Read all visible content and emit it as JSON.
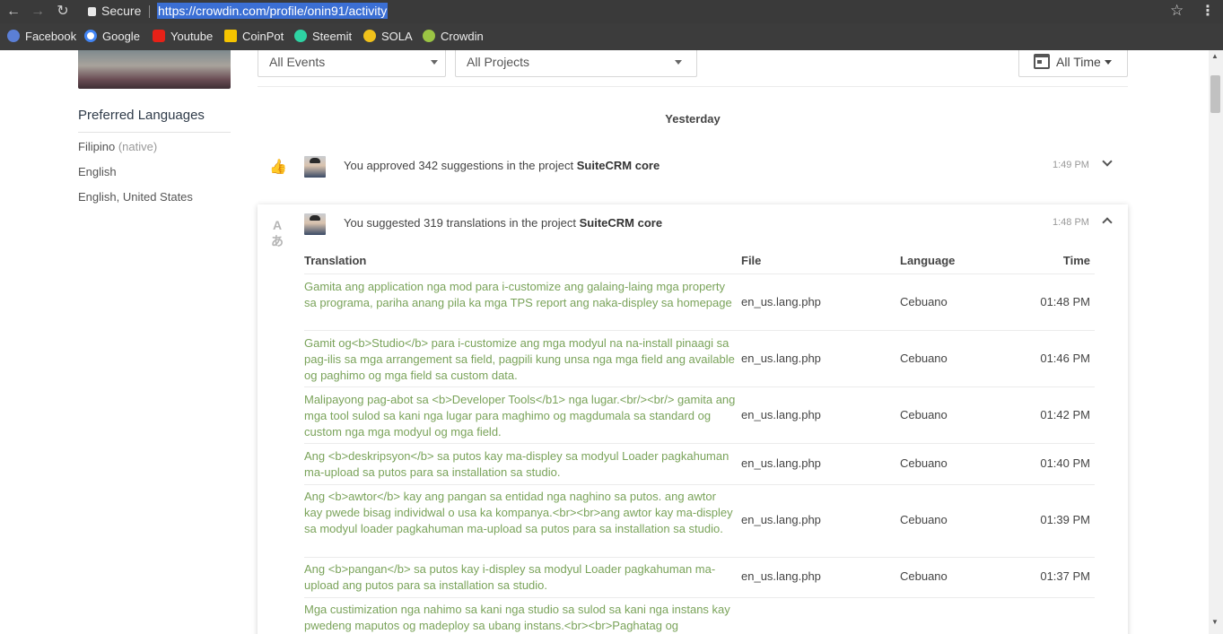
{
  "browser": {
    "secure_label": "Secure",
    "url": "https://crowdin.com/profile/onin91/activity",
    "bookmarks": [
      {
        "label": "Facebook",
        "color": "#5b7fd6"
      },
      {
        "label": "Google",
        "color": "#ffffff"
      },
      {
        "label": "Youtube",
        "color": "#e62117"
      },
      {
        "label": "CoinPot",
        "color": "#f5c400"
      },
      {
        "label": "Steemit",
        "color": "#2ed3a3"
      },
      {
        "label": "SOLA",
        "color": "#f1c21b"
      },
      {
        "label": "Crowdin",
        "color": "#9bc444"
      }
    ]
  },
  "sidebar": {
    "title": "Preferred Languages",
    "languages": [
      {
        "name": "Filipino",
        "note": "(native)"
      },
      {
        "name": "English",
        "note": ""
      },
      {
        "name": "English, United States",
        "note": ""
      }
    ]
  },
  "filters": {
    "events": "All Events",
    "projects": "All Projects",
    "time": "All Time"
  },
  "day_label": "Yesterday",
  "events": [
    {
      "text": "You approved 342 suggestions in the project",
      "project": "SuiteCRM core",
      "time": "1:49 PM",
      "icon": "thumbs-up-icon"
    },
    {
      "text": "You suggested 319 translations in the project",
      "project": "SuiteCRM core",
      "time": "1:48 PM",
      "icon": "translate-icon"
    }
  ],
  "table": {
    "headers": {
      "translation": "Translation",
      "file": "File",
      "language": "Language",
      "time": "Time"
    },
    "rows": [
      {
        "translation": "Gamita ang application nga mod para i-customize ang galaing-laing mga property sa programa, pariha anang pila ka mga TPS report ang naka-displey sa homepage",
        "file": "en_us.lang.php",
        "language": "Cebuano",
        "time": "01:48 PM"
      },
      {
        "translation": "Gamit og<b>Studio</b> para i-customize ang mga modyul na na-install pinaagi sa pag-ilis sa mga arrangement sa field, pagpili kung unsa nga mga field ang available og paghimo og mga field sa custom data.",
        "file": "en_us.lang.php",
        "language": "Cebuano",
        "time": "01:46 PM"
      },
      {
        "translation": "Malipayong pag-abot sa <b>Developer Tools</b1> nga lugar.<br/><br/> gamita ang mga tool sulod sa kani nga lugar para maghimo og magdumala sa standard og custom nga mga modyul og mga field.",
        "file": "en_us.lang.php",
        "language": "Cebuano",
        "time": "01:42 PM"
      },
      {
        "translation": "Ang <b>deskripsyon</b> sa putos kay ma-displey sa modyul Loader pagkahuman ma-upload sa putos para sa installation sa studio.",
        "file": "en_us.lang.php",
        "language": "Cebuano",
        "time": "01:40 PM"
      },
      {
        "translation": "Ang <b>awtor</b> kay ang pangan sa entidad nga naghino sa putos. ang awtor kay pwede bisag individwal o usa ka kompanya.<br><br>ang awtor kay ma-displey sa modyul loader pagkahuman ma-upload sa putos para sa installation sa studio.",
        "file": "en_us.lang.php",
        "language": "Cebuano",
        "time": "01:39 PM"
      },
      {
        "translation": "Ang <b>pangan</b> sa putos kay i-displey sa modyul Loader pagkahuman ma-upload ang putos para sa installation sa studio.",
        "file": "en_us.lang.php",
        "language": "Cebuano",
        "time": "01:37 PM"
      },
      {
        "translation": "Mga custimization nga nahimo sa kani nga studio sa sulod sa kani nga instans kay pwedeng maputos og madeploy sa ubang instans.<br><br>Paghatag og",
        "file": "",
        "language": "",
        "time": ""
      }
    ]
  }
}
